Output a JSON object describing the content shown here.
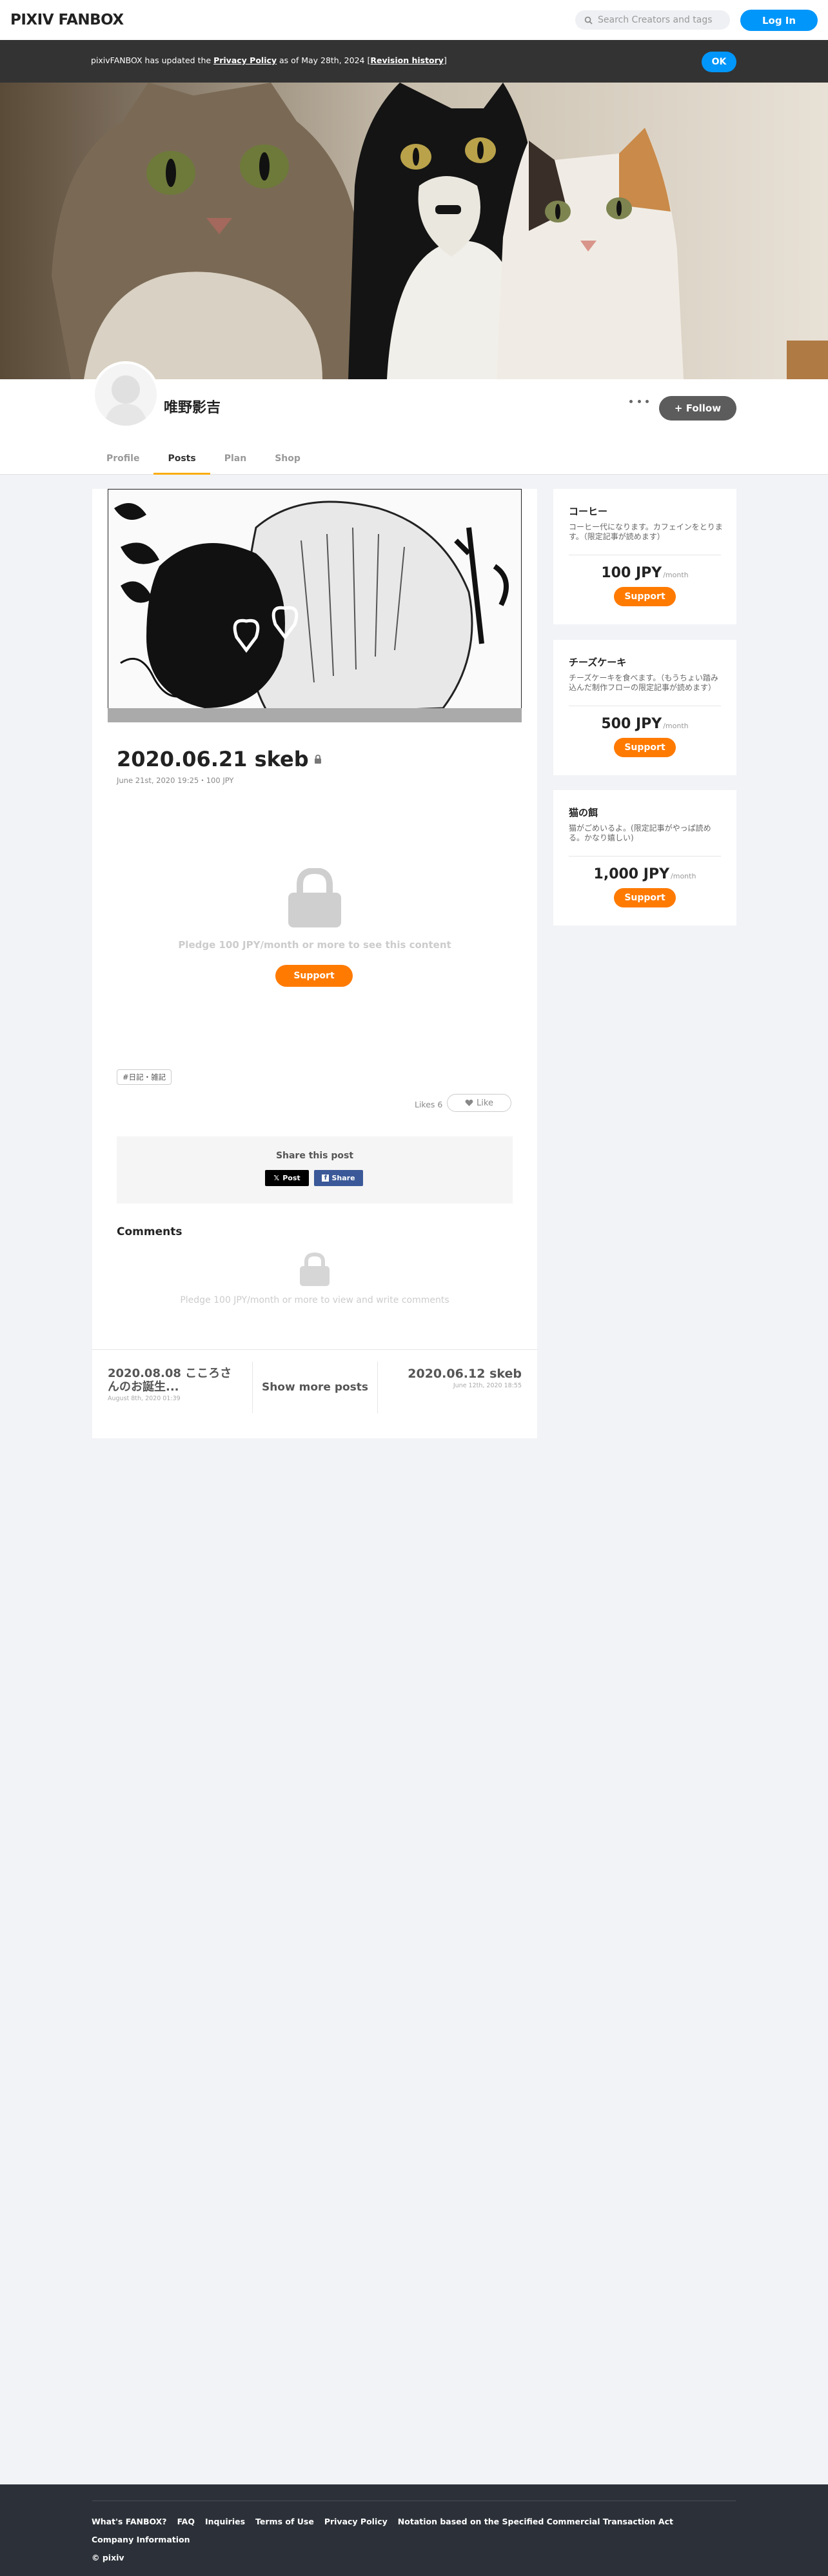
{
  "header": {
    "logo": "PIXIV FANBOX",
    "search_placeholder": "Search Creators and tags",
    "login_label": "Log In"
  },
  "notice": {
    "prefix": "pixivFANBOX has updated the ",
    "policy_link": "Privacy Policy",
    "middle": " as of May 28th, 2024 [",
    "history_link": "Revision history",
    "suffix": "]",
    "ok_label": "OK"
  },
  "creator": {
    "name": "唯野影吉",
    "follow_label": "+ Follow"
  },
  "tabs": [
    "Profile",
    "Posts",
    "Plan",
    "Shop"
  ],
  "post": {
    "title": "2020.06.21 skeb",
    "meta": "June 21st, 2020 19:25・100 JPY",
    "pledge_text": "Pledge 100 JPY/month or more to see this content",
    "support_label": "Support",
    "tag": "#日記・雑記",
    "likes_text": "Likes 6",
    "like_label": "Like",
    "share_title": "Share this post",
    "share_x": "Post",
    "share_fb": "Share",
    "comments_title": "Comments",
    "comments_pledge": "Pledge 100 JPY/month or more to view and write comments"
  },
  "post_nav": {
    "prev_title": "2020.08.08 こころさんのお誕生...",
    "prev_date": "August 8th, 2020 01:39",
    "show_more": "Show more posts",
    "next_title": "2020.06.12 skeb",
    "next_date": "June 12th, 2020 18:55"
  },
  "plans": [
    {
      "name": "コーヒー",
      "desc": "コーヒー代になります。カフェインをとります。（限定記事が読めます）",
      "price": "100 JPY",
      "per": "/month",
      "support": "Support"
    },
    {
      "name": "チーズケーキ",
      "desc": "チーズケーキを食べます。（もうちょい踏み込んだ制作フローの限定記事が読めます）",
      "price": "500 JPY",
      "per": "/month",
      "support": "Support"
    },
    {
      "name": "猫の餌",
      "desc": "猫がごめいるよ。(限定記事がやっぱ読める。かなり嬉しい)",
      "price": "1,000 JPY",
      "per": "/month",
      "support": "Support"
    }
  ],
  "footer": {
    "links": [
      "What's FANBOX?",
      "FAQ",
      "Inquiries",
      "Terms of Use",
      "Privacy Policy",
      "Notation based on the Specified Commercial Transaction Act"
    ],
    "company": "Company Information",
    "copyright": "© pixiv"
  },
  "colors": {
    "accent_blue": "#0096fa",
    "support_orange": "#ff7a00",
    "tab_underline": "#faad14",
    "footer_bg": "#2c3139"
  }
}
